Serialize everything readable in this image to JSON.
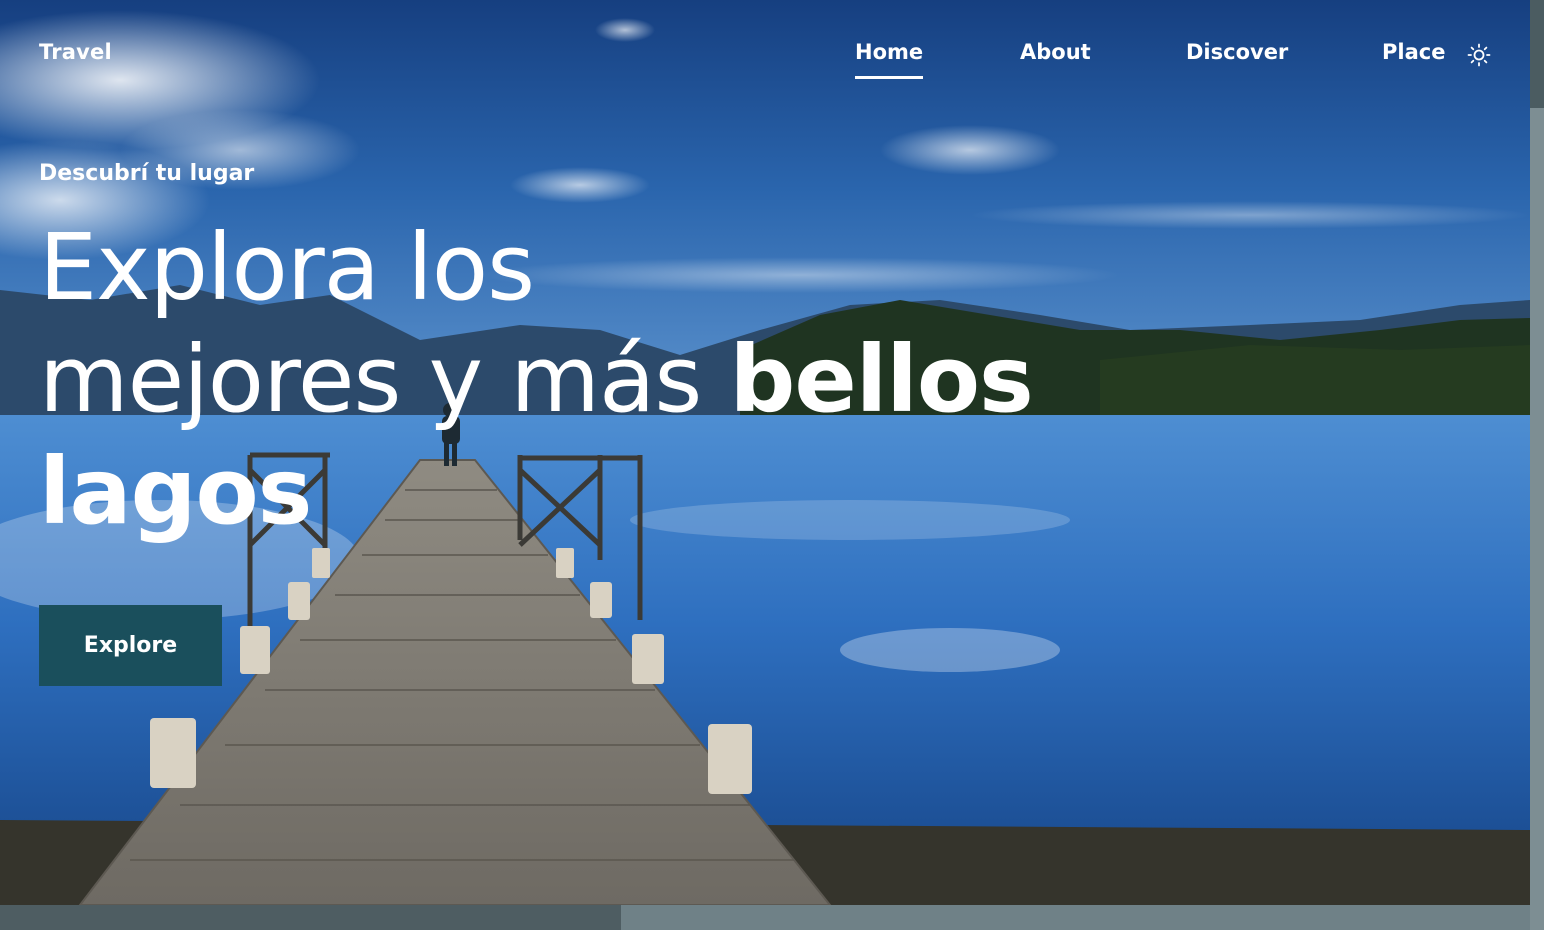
{
  "header": {
    "logo": "Travel",
    "nav": [
      {
        "label": "Home",
        "active": true
      },
      {
        "label": "About",
        "active": false
      },
      {
        "label": "Discover",
        "active": false
      },
      {
        "label": "Place",
        "active": false
      }
    ],
    "theme_toggle_icon": "sun-icon"
  },
  "hero": {
    "subtitle": "Descubrí tu lugar",
    "title_line1": "Explora los",
    "title_line2_regular": "mejores y más ",
    "title_line2_bold": "bellos",
    "title_line3_bold": "lagos",
    "button_label": "Explore",
    "background_image": "lake with wooden pier, mountains and blue sky"
  },
  "colors": {
    "button_bg": "#1a4f5c",
    "text": "#ffffff",
    "sky_top": "#1d4f8f",
    "lake": "#2f6fb8"
  }
}
